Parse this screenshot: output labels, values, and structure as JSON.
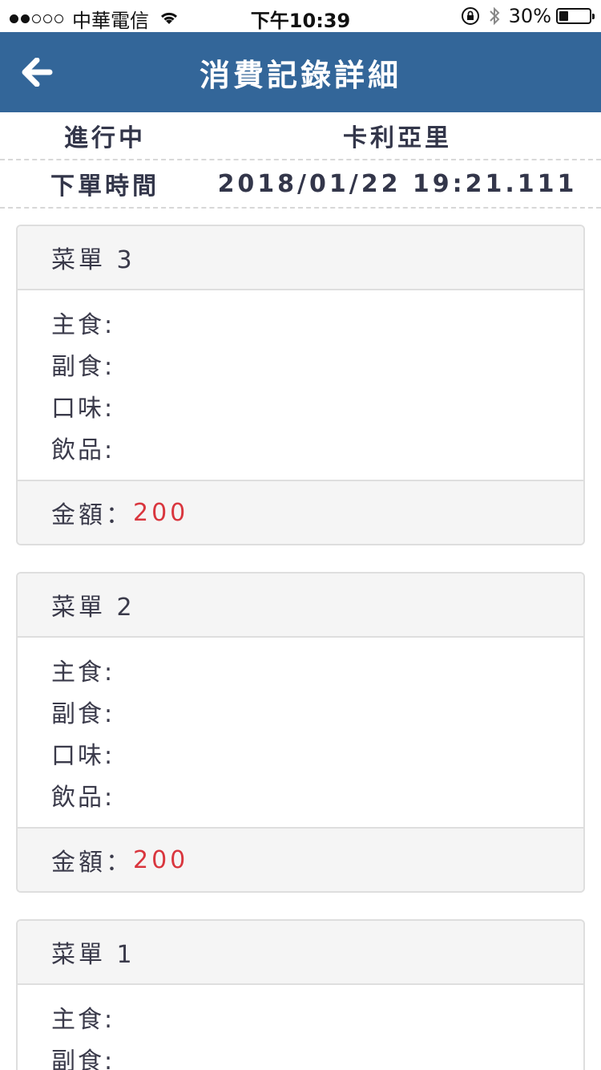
{
  "status_bar": {
    "carrier": "中華電信",
    "time": "下午10:39",
    "battery": "30%",
    "battery_level": 0.3
  },
  "nav": {
    "title": "消費記錄詳細",
    "back_icon": "arrow-left-icon"
  },
  "order": {
    "status": "進行中",
    "restaurant": "卡利亞里",
    "time_label": "下單時間",
    "time_value": "2018/01/22 19:21.111"
  },
  "menus": [
    {
      "title": "菜單 3",
      "items": [
        "主食:",
        "副食:",
        "口味:",
        "飲品:"
      ],
      "amount_label": "金額：",
      "amount": "200"
    },
    {
      "title": "菜單 2",
      "items": [
        "主食:",
        "副食:",
        "口味:",
        "飲品:"
      ],
      "amount_label": "金額：",
      "amount": "200"
    },
    {
      "title": "菜單 1",
      "items": [
        "主食:",
        "副食:"
      ],
      "amount_label": "",
      "amount": ""
    }
  ],
  "colors": {
    "nav_bg": "#336699",
    "amount": "#d9363e"
  }
}
